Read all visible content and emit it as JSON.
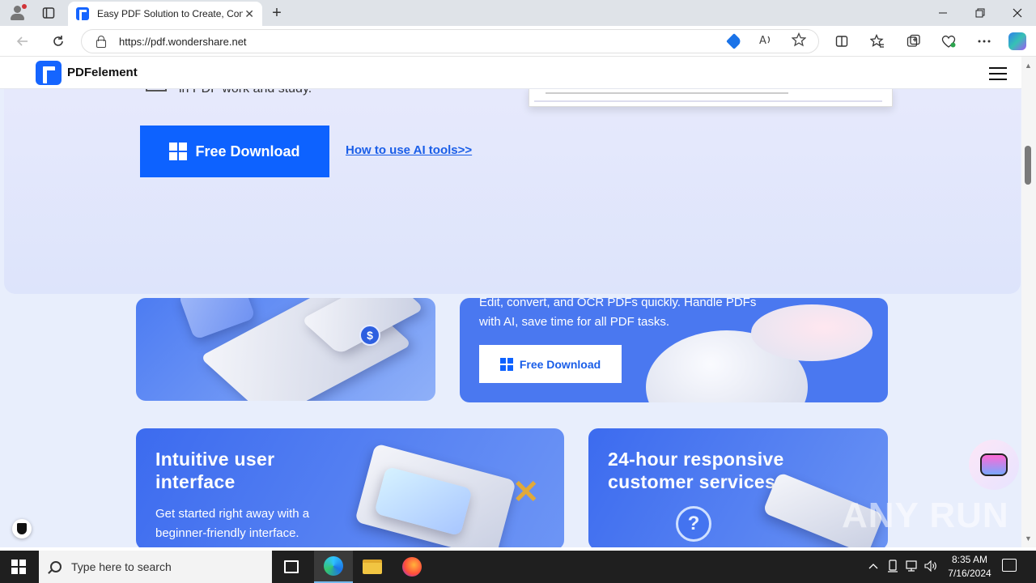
{
  "browser": {
    "tab_title": "Easy PDF Solution to Create, Con",
    "url": "https://pdf.wondershare.net",
    "new_tab_label": "+",
    "tab_close": "✕"
  },
  "site": {
    "logo_text": "PDFelement"
  },
  "hero": {
    "subtitle_fragment": "in PDF work and study.",
    "download_label": "Free Download",
    "ai_link": "How to use AI tools>>"
  },
  "cards": {
    "convert_text_line1": "Edit, convert, and OCR PDFs quickly. Handle PDFs",
    "convert_text_line2": "with AI, save time for all PDF tasks.",
    "convert_button": "Free Download",
    "ui_title_line1": "Intuitive user",
    "ui_title_line2": "interface",
    "ui_text_line1": "Get started right away with a",
    "ui_text_line2": "beginner-friendly interface.",
    "support_title_line1": "24-hour responsive",
    "support_title_line2": "customer services"
  },
  "overlay": {
    "watermark": "ANY RUN"
  },
  "taskbar": {
    "search_placeholder": "Type here to search",
    "time": "8:35 AM",
    "date": "7/16/2024"
  },
  "colors": {
    "brand_blue": "#0d62ff",
    "card_blue": "#4a78f0",
    "link_blue": "#1a5ee8"
  }
}
